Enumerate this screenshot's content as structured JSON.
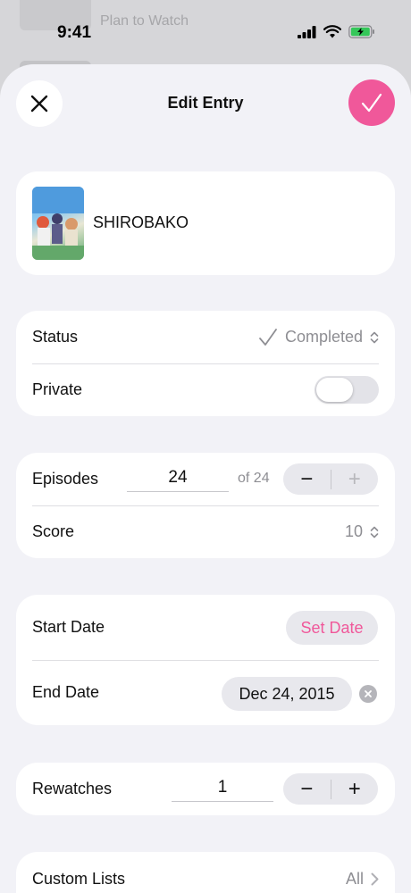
{
  "background": {
    "peek_text": "Plan to Watch"
  },
  "status_bar": {
    "time": "9:41"
  },
  "nav": {
    "title": "Edit Entry"
  },
  "entry": {
    "title": "SHIROBAKO"
  },
  "status_card": {
    "status_label": "Status",
    "status_value": "Completed",
    "private_label": "Private",
    "private_on": false
  },
  "progress_card": {
    "episodes_label": "Episodes",
    "episodes_value": "24",
    "episodes_total": "of 24",
    "minus": "−",
    "plus": "+",
    "score_label": "Score",
    "score_value": "10"
  },
  "dates_card": {
    "start_label": "Start Date",
    "start_value": "Set Date",
    "end_label": "End Date",
    "end_value": "Dec 24, 2015"
  },
  "rewatch_card": {
    "rewatches_label": "Rewatches",
    "rewatches_value": "1",
    "minus": "−",
    "plus": "+"
  },
  "lists_card": {
    "custom_lists_label": "Custom Lists",
    "custom_lists_value": "All"
  },
  "colors": {
    "accent": "#f0589a",
    "background": "#f2f2f7",
    "card": "#ffffff",
    "secondary_text": "#8e8e93"
  }
}
